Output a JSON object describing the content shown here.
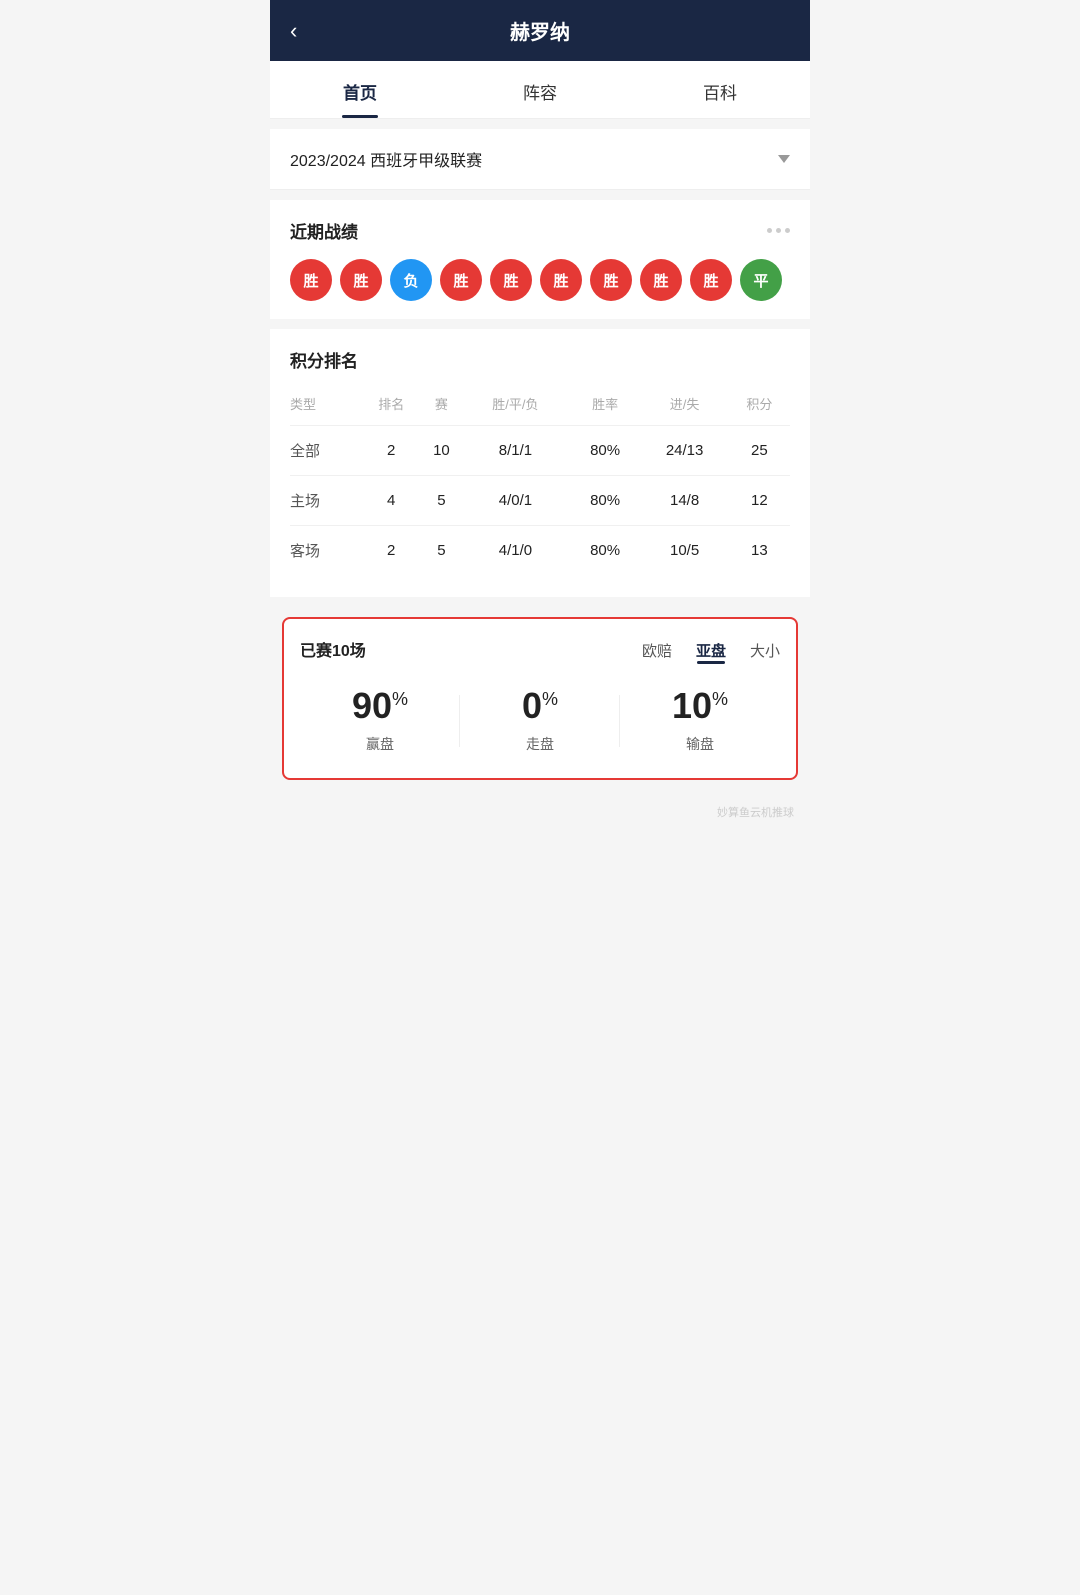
{
  "header": {
    "title": "赫罗纳",
    "back_label": "‹"
  },
  "tabs": [
    {
      "label": "首页",
      "active": true
    },
    {
      "label": "阵容",
      "active": false
    },
    {
      "label": "百科",
      "active": false
    }
  ],
  "season": {
    "text": "2023/2024 西班牙甲级联赛"
  },
  "recent": {
    "title": "近期战绩",
    "results": [
      {
        "label": "胜",
        "type": "win"
      },
      {
        "label": "胜",
        "type": "win"
      },
      {
        "label": "负",
        "type": "lose"
      },
      {
        "label": "胜",
        "type": "win"
      },
      {
        "label": "胜",
        "type": "win"
      },
      {
        "label": "胜",
        "type": "win"
      },
      {
        "label": "胜",
        "type": "win"
      },
      {
        "label": "胜",
        "type": "win"
      },
      {
        "label": "胜",
        "type": "win"
      },
      {
        "label": "平",
        "type": "draw"
      }
    ]
  },
  "standings": {
    "title": "积分排名",
    "headers": [
      "类型",
      "排名",
      "赛",
      "胜/平/负",
      "胜率",
      "进/失",
      "积分"
    ],
    "rows": [
      [
        "全部",
        "2",
        "10",
        "8/1/1",
        "80%",
        "24/13",
        "25"
      ],
      [
        "主场",
        "4",
        "5",
        "4/0/1",
        "80%",
        "14/8",
        "12"
      ],
      [
        "客场",
        "2",
        "5",
        "4/1/0",
        "80%",
        "10/5",
        "13"
      ]
    ]
  },
  "analysis": {
    "left_title": "已赛10场",
    "header_labels": [
      "欧赔",
      "亚盘",
      "大小"
    ],
    "active_tab": "亚盘",
    "stats": [
      {
        "percent": "90",
        "label": "赢盘"
      },
      {
        "percent": "0",
        "label": "走盘"
      },
      {
        "percent": "10",
        "label": "输盘"
      }
    ]
  },
  "watermark": "妙算鱼云机推球"
}
